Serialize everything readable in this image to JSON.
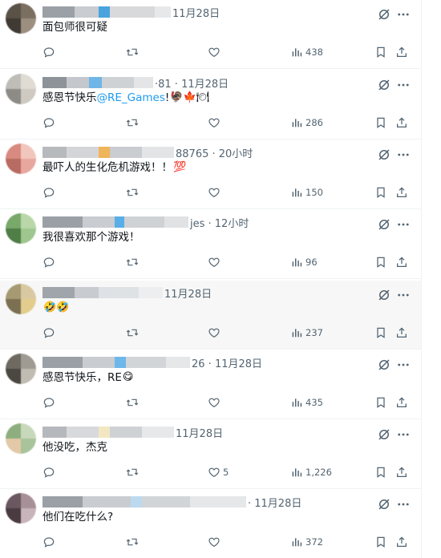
{
  "replies": [
    {
      "time": "11月28日",
      "text": "面包师很可疑",
      "mention": "",
      "emoji": "",
      "counts": {
        "reply": "",
        "retweet": "",
        "like": "",
        "views": "438"
      }
    },
    {
      "time": "·81 · 11月28日",
      "text": "感恩节快乐",
      "mention": "@RE_Games",
      "tail": "!",
      "emoji": "🦃🍁🍽",
      "counts": {
        "reply": "",
        "retweet": "",
        "like": "",
        "views": "286"
      }
    },
    {
      "time": "88765 · 20小时",
      "text": "最吓人的生化危机游戏！！",
      "mention": "",
      "emoji": "💯",
      "counts": {
        "reply": "",
        "retweet": "",
        "like": "",
        "views": "150"
      }
    },
    {
      "time": "jes · 12小时",
      "text": "我很喜欢那个游戏！",
      "mention": "",
      "emoji": "",
      "counts": {
        "reply": "",
        "retweet": "",
        "like": "",
        "views": "96"
      }
    },
    {
      "time": "11月28日",
      "text": "",
      "mention": "",
      "emoji": "🤣🤣",
      "counts": {
        "reply": "",
        "retweet": "",
        "like": "",
        "views": "237"
      }
    },
    {
      "time": "26 · 11月28日",
      "text": "感恩节快乐，RE",
      "mention": "",
      "emoji": "😋",
      "counts": {
        "reply": "",
        "retweet": "",
        "like": "",
        "views": "435"
      }
    },
    {
      "time": "11月28日",
      "text": "他没吃，杰克",
      "mention": "",
      "emoji": "",
      "counts": {
        "reply": "",
        "retweet": "",
        "like": "5",
        "views": "1,226"
      }
    },
    {
      "time": "· 11月28日",
      "text": "他们在吃什么?",
      "mention": "",
      "emoji": "",
      "counts": {
        "reply": "",
        "retweet": "",
        "like": "",
        "views": "372"
      }
    }
  ],
  "icons": {
    "reply": "reply-icon",
    "retweet": "retweet-icon",
    "like": "heart-icon",
    "views": "views-icon",
    "bookmark": "bookmark-icon",
    "share": "share-icon",
    "grok": "grok-icon",
    "more": "more-icon"
  },
  "colors": {
    "text": "#0f1419",
    "muted": "#536471",
    "link": "#1d9bf0",
    "divider": "#eff3f4",
    "highlight": "#f7f7f7"
  }
}
